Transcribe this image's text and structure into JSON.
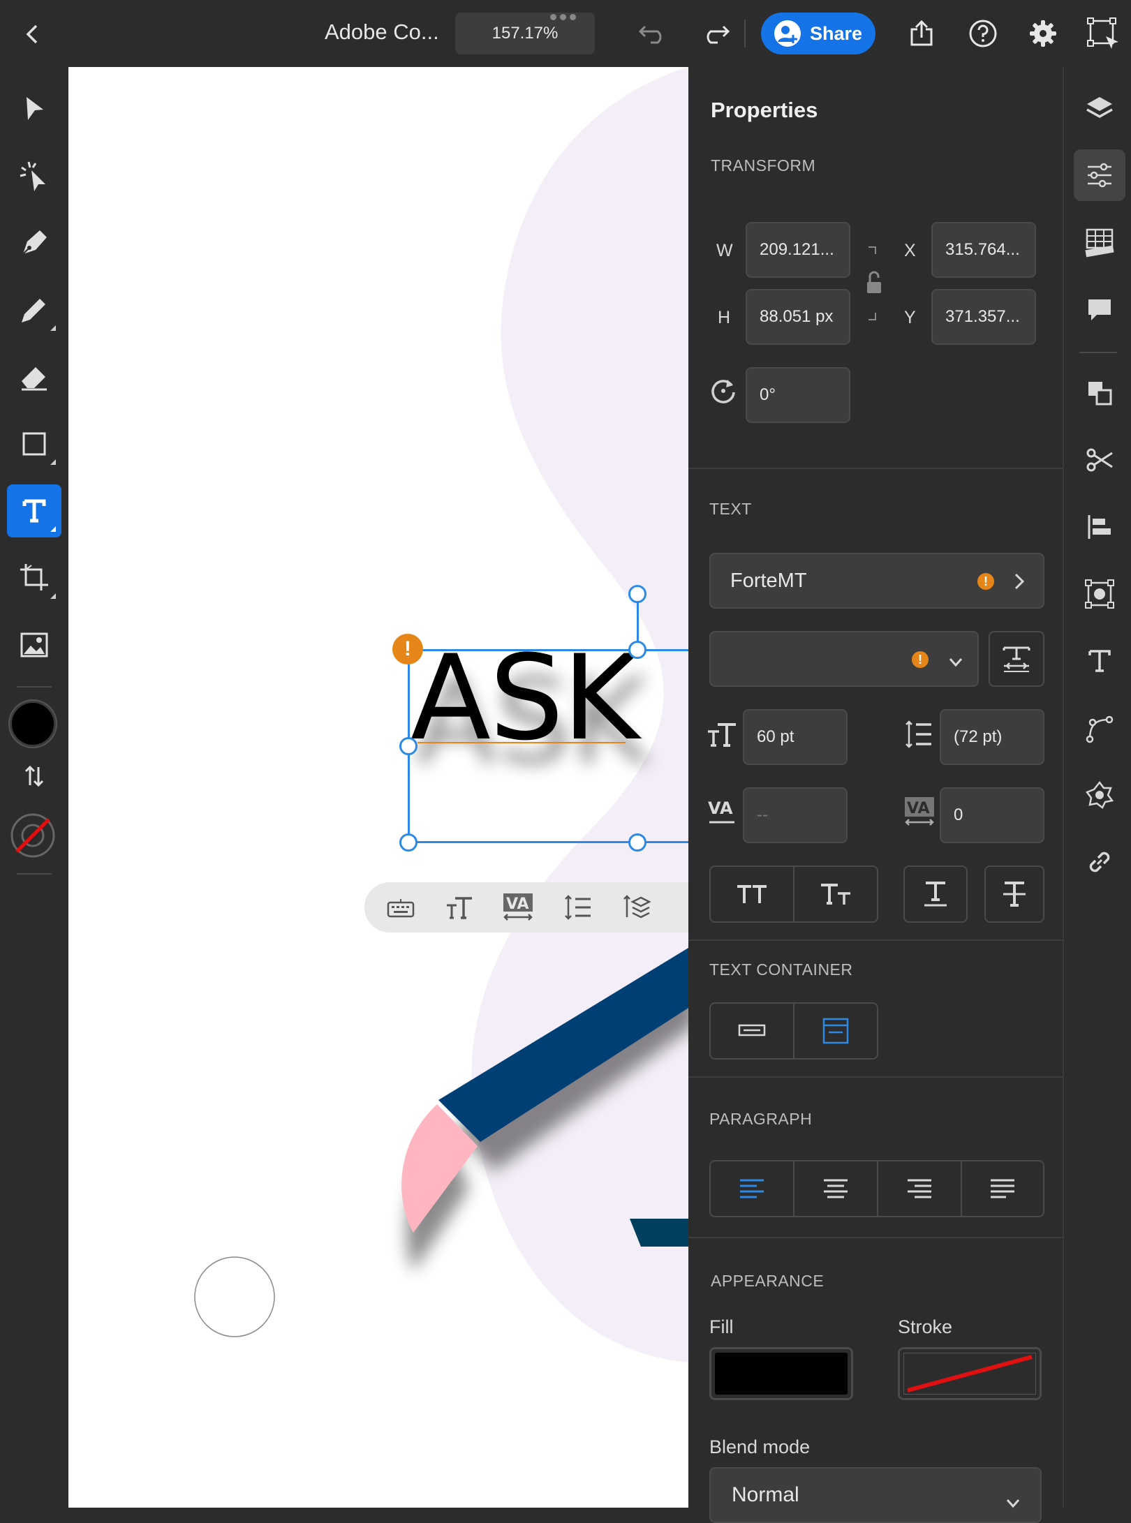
{
  "topbar": {
    "doc_title": "Adobe Co...",
    "zoom": "157.17%",
    "share_label": "Share"
  },
  "canvas": {
    "text_content": "ASK"
  },
  "panel": {
    "title": "Properties",
    "transform": {
      "section": "TRANSFORM",
      "w_label": "W",
      "w_value": "209.121...",
      "h_label": "H",
      "h_value": "88.051 px",
      "x_label": "X",
      "x_value": "315.764...",
      "y_label": "Y",
      "y_value": "371.357...",
      "rotation": "0°"
    },
    "text": {
      "section": "TEXT",
      "font": "ForteMT",
      "style": "",
      "size": "60 pt",
      "leading": "(72 pt)",
      "kerning": "--",
      "tracking": "0"
    },
    "text_container": {
      "section": "TEXT CONTAINER"
    },
    "paragraph": {
      "section": "PARAGRAPH"
    },
    "appearance": {
      "section": "APPEARANCE",
      "fill_label": "Fill",
      "stroke_label": "Stroke",
      "blend_label": "Blend mode",
      "blend_value": "Normal"
    }
  },
  "colors": {
    "accent": "#1473e6",
    "warning": "#e68619",
    "fill": "#000000",
    "stroke_none": "#e01010",
    "blob": "#f3eef7",
    "sleeve": "#003f74",
    "hand": "#ffb6c1"
  }
}
